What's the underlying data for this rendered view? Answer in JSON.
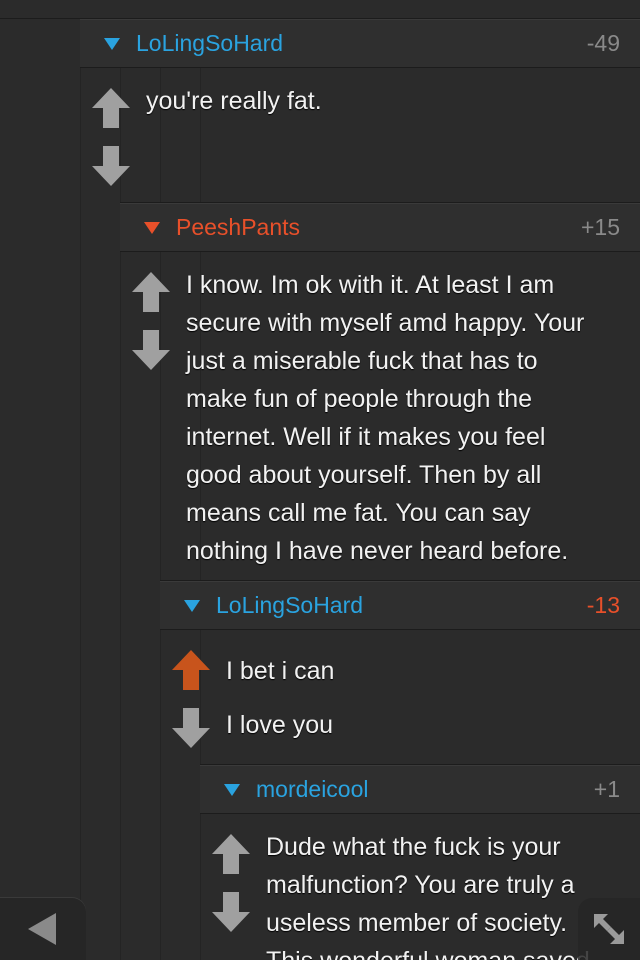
{
  "comments": [
    {
      "username": "LoLingSoHard",
      "score": "-49",
      "username_color": "#2aa3e0",
      "score_color": "#8a8a8a",
      "lines": [
        "you're really fat."
      ],
      "upvoted": false
    },
    {
      "username": "PeeshPants",
      "score": "+15",
      "username_color": "#e8502a",
      "score_color": "#8a8a8a",
      "lines": [
        "I know. Im ok with it. At least I am",
        "secure with myself amd happy. Your",
        "just a miserable fuck that has to",
        "make fun of people through the",
        "internet.  Well if it makes you feel",
        "good about yourself. Then by all",
        "means call me fat. You can say",
        "nothing I have never heard before."
      ],
      "upvoted": false
    },
    {
      "username": "LoLingSoHard",
      "score": "-13",
      "username_color": "#2aa3e0",
      "score_color": "#e8502a",
      "lines": [
        "I bet i can",
        "I love you"
      ],
      "upvoted": true
    },
    {
      "username": "mordeicool",
      "score": "+1",
      "username_color": "#2aa3e0",
      "score_color": "#8a8a8a",
      "lines": [
        "Dude what the fuck is your",
        "malfunction? You are truly a",
        "useless member of society.",
        "This wonderful woman saved"
      ],
      "upvoted": false
    }
  ],
  "icons": {
    "upvote": "up-arrow-icon",
    "downvote": "down-arrow-icon",
    "back": "back-arrow-icon",
    "collapse": "collapse-icon"
  },
  "colors": {
    "background": "#2b2b2b",
    "arrow_gray": "#a0a0a0",
    "arrow_orange": "#c8541c",
    "accent_blue": "#2aa3e0",
    "accent_red": "#e8502a"
  }
}
